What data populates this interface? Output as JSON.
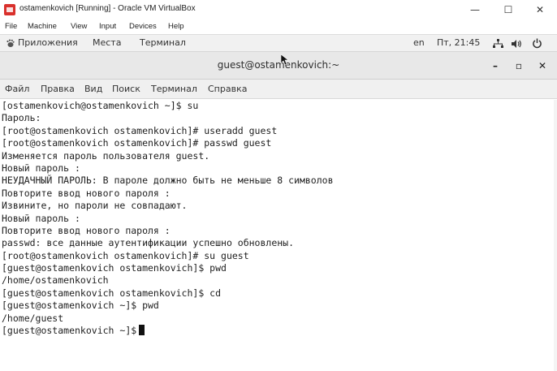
{
  "vbox": {
    "title": "ostamenkovich [Running] - Oracle VM VirtualBox",
    "menu": [
      "File",
      "Machine",
      "View",
      "Input",
      "Devices",
      "Help"
    ],
    "minimize": "—",
    "maximize": "☐",
    "close": "✕"
  },
  "gnome": {
    "apps_label": "Приложения",
    "places_label": "Места",
    "terminal_label": "Терминал",
    "lang": "en",
    "clock": "Пт, 21:45"
  },
  "terminal": {
    "title": "guest@ostamenkovich:~",
    "minimize": "–",
    "maximize": "▫",
    "close": "✕",
    "menu": [
      "Файл",
      "Правка",
      "Вид",
      "Поиск",
      "Терминал",
      "Справка"
    ],
    "lines": [
      "[ostamenkovich@ostamenkovich ~]$ su",
      "Пароль:",
      "[root@ostamenkovich ostamenkovich]# useradd guest",
      "[root@ostamenkovich ostamenkovich]# passwd guest",
      "Изменяется пароль пользователя guest.",
      "Новый пароль :",
      "НЕУДАЧНЫЙ ПАРОЛЬ: В пароле должно быть не меньше 8 символов",
      "Повторите ввод нового пароля :",
      "Извините, но пароли не совпадают.",
      "Новый пароль :",
      "Повторите ввод нового пароля :",
      "passwd: все данные аутентификации успешно обновлены.",
      "[root@ostamenkovich ostamenkovich]# su guest",
      "[guest@ostamenkovich ostamenkovich]$ pwd",
      "/home/ostamenkovich",
      "[guest@ostamenkovich ostamenkovich]$ cd",
      "[guest@ostamenkovich ~]$ pwd",
      "/home/guest"
    ],
    "prompt": "[guest@ostamenkovich ~]$"
  },
  "colors": {
    "vbox_logo": "#d9302c",
    "terminal_bg": "#ffffff",
    "terminal_fg": "#1e1e1e"
  }
}
